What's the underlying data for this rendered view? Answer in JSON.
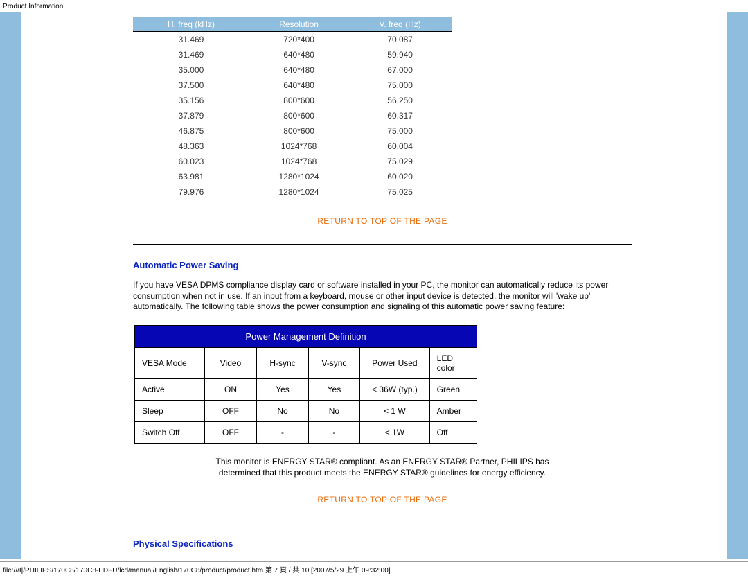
{
  "header": "Product Information",
  "footer": "file:///I|/PHILIPS/170C8/170C8-EDFU/lcd/manual/English/170C8/product/product.htm 第 7 頁 / 共 10  [2007/5/29 上午 09:32:00]",
  "freq_table": {
    "headers": [
      "H. freq (kHz)",
      "Resolution",
      "V. freq (Hz)"
    ],
    "rows": [
      [
        "31.469",
        "720*400",
        "70.087"
      ],
      [
        "31.469",
        "640*480",
        "59.940"
      ],
      [
        "35.000",
        "640*480",
        "67.000"
      ],
      [
        "37.500",
        "640*480",
        "75.000"
      ],
      [
        "35.156",
        "800*600",
        "56.250"
      ],
      [
        "37.879",
        "800*600",
        "60.317"
      ],
      [
        "46.875",
        "800*600",
        "75.000"
      ],
      [
        "48.363",
        "1024*768",
        "60.004"
      ],
      [
        "60.023",
        "1024*768",
        "75.029"
      ],
      [
        "63.981",
        "1280*1024",
        "60.020"
      ],
      [
        "79.976",
        "1280*1024",
        "75.025"
      ]
    ]
  },
  "return_link": "RETURN TO TOP OF THE PAGE",
  "section1": {
    "heading": "Automatic Power Saving",
    "para": "If you have VESA DPMS compliance display card or software installed in your PC, the monitor can automatically reduce its power consumption when not in use. If an input from a keyboard, mouse or other input device is detected, the monitor will 'wake up' automatically. The following table shows the power consumption and signaling of this automatic power saving feature:"
  },
  "power_table": {
    "title": "Power Management Definition",
    "headers": [
      "VESA Mode",
      "Video",
      "H-sync",
      "V-sync",
      "Power Used",
      "LED color"
    ],
    "rows": [
      [
        "Active",
        "ON",
        "Yes",
        "Yes",
        "< 36W (typ.)",
        "Green"
      ],
      [
        "Sleep",
        "OFF",
        "No",
        "No",
        "< 1 W",
        "Amber"
      ],
      [
        "Switch Off",
        "OFF",
        "-",
        "-",
        "< 1W",
        "Off"
      ]
    ]
  },
  "compliance_line1": "This monitor is ENERGY STAR® compliant. As an ENERGY STAR® Partner, PHILIPS has",
  "compliance_line2": "determined that this product meets the ENERGY STAR® guidelines for energy efficiency.",
  "section2_heading": "Physical Specifications"
}
